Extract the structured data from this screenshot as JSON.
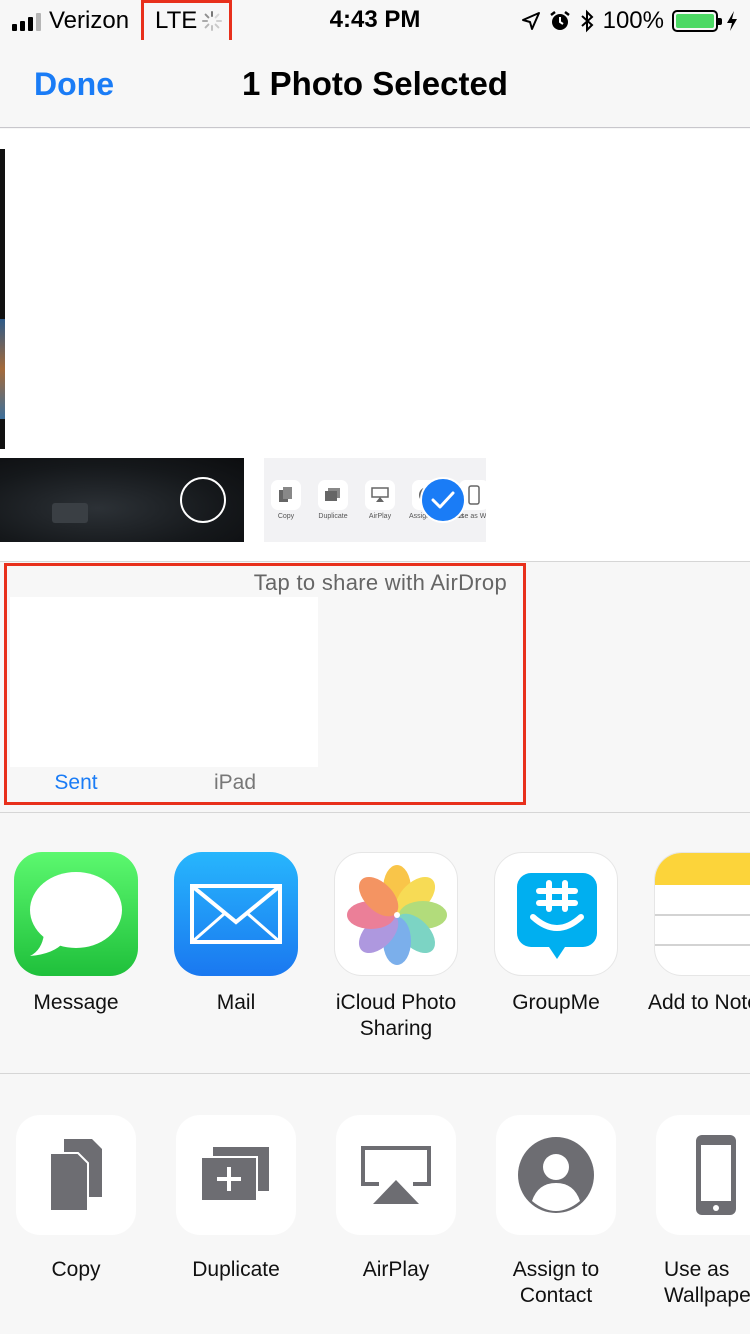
{
  "status_bar": {
    "carrier": "Verizon",
    "network": "LTE",
    "time": "4:43 PM",
    "battery_percent": "100%",
    "battery_level": 1.0,
    "icons": [
      "signal-icon",
      "loading-spinner-icon",
      "location-arrow-icon",
      "alarm-icon",
      "bluetooth-icon",
      "battery-icon",
      "charging-bolt-icon"
    ]
  },
  "nav": {
    "done_label": "Done",
    "title": "1 Photo Selected"
  },
  "photos": {
    "thumbnails": [
      {
        "kind": "dark-photo",
        "selected": false
      },
      {
        "kind": "share-sheet-screenshot",
        "selected": true
      }
    ],
    "mini_labels": [
      "Copy",
      "Duplicate",
      "AirPlay",
      "Assign to Contact",
      "Use as Wallpaper"
    ]
  },
  "airdrop": {
    "hint": "Tap to share with AirDrop",
    "targets": [
      {
        "label": "Sent"
      },
      {
        "label": "iPad"
      }
    ]
  },
  "apps": [
    {
      "label": "Message",
      "icon": "message-icon"
    },
    {
      "label": "Mail",
      "icon": "mail-icon"
    },
    {
      "label": "iCloud Photo Sharing",
      "icon": "photos-icon"
    },
    {
      "label": "GroupMe",
      "icon": "groupme-icon"
    },
    {
      "label": "Add to Notes",
      "icon": "notes-icon"
    }
  ],
  "actions": [
    {
      "label": "Copy",
      "icon": "copy-icon"
    },
    {
      "label": "Duplicate",
      "icon": "duplicate-icon"
    },
    {
      "label": "AirPlay",
      "icon": "airplay-icon"
    },
    {
      "label": "Assign to Contact",
      "icon": "contact-icon"
    },
    {
      "label": "Use as Wallpaper",
      "icon": "wallpaper-icon"
    }
  ],
  "colors": {
    "accent": "#1a7cf6",
    "highlight_box": "#e8301c",
    "battery_green": "#4cd964",
    "background": "#f7f7f7"
  }
}
